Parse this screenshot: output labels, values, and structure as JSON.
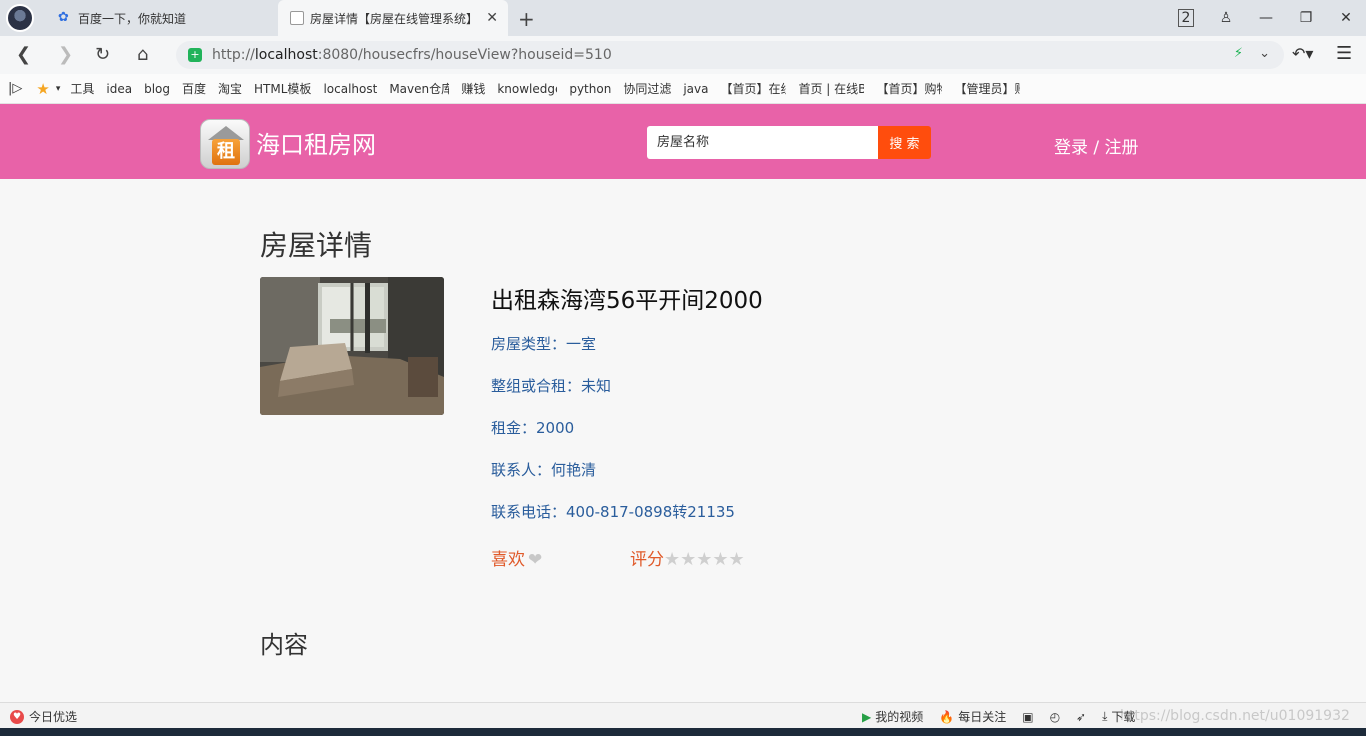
{
  "browser": {
    "tabs": [
      {
        "title": "百度一下，你就知道",
        "icon": "baidu-paw-icon"
      },
      {
        "title": "房屋详情【房屋在线管理系统】",
        "icon": "document-icon",
        "active": true
      }
    ],
    "tab_count": "2",
    "url_host": "localhost",
    "url_prefix": "http://",
    "url_rest": ":8080/housecfrs/houseView?houseid=510",
    "bookmarks": [
      "工具",
      "idea",
      "blog",
      "百度",
      "淘宝",
      "HTML模板",
      "localhost",
      "Maven仓库",
      "赚钱",
      "knowledge",
      "python",
      "协同过滤",
      "java",
      "【首页】在线",
      "首页 | 在线B",
      "【首页】购物",
      "【管理员】账"
    ]
  },
  "header": {
    "logo_char": "租",
    "site_title": "海口租房网",
    "search_placeholder": "房屋名称",
    "search_button": "搜 索",
    "login_label": "登录 / 注册"
  },
  "main": {
    "page_title": "房屋详情",
    "house_name": "出租森海湾56平开间2000",
    "info": {
      "type": "房屋类型：一室",
      "rent_mode": "整组或合租：未知",
      "rent": "租金：2000",
      "contact": "联系人：何艳清",
      "phone": "联系电话：400-817-0898转21135"
    },
    "like_label": "喜欢",
    "rating_label": "评分",
    "rating_stars": "★★★★★",
    "rating_value": 0,
    "content_title": "内容"
  },
  "statusbar": {
    "today_pick": "今日优选",
    "my_video": "我的视频",
    "daily_focus": "每日关注",
    "download": "下载",
    "watermark": "https://blog.csdn.net/u01091932"
  },
  "colors": {
    "header_bg": "#e862a8",
    "search_button": "#ff4d0d",
    "info_text": "#2a5d9c",
    "accent_text": "#e05a2a"
  }
}
